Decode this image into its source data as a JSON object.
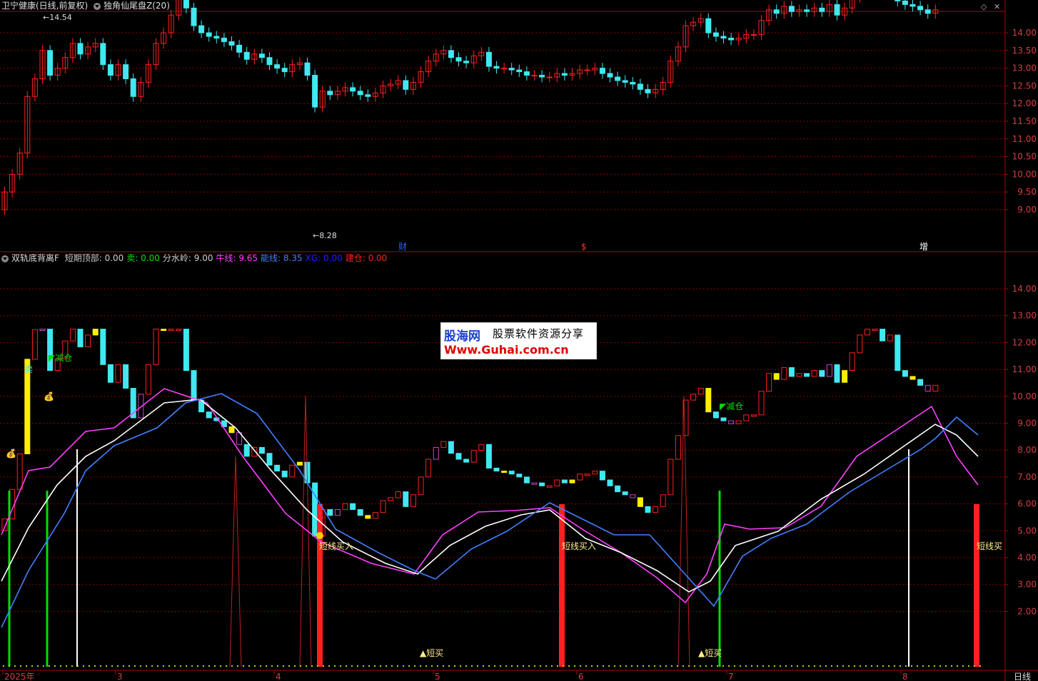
{
  "top_panel": {
    "stock_title": "卫宁健康(日线,前复权)",
    "indicator_title": "独角仙尾盘Z(20)",
    "y_ticks": [
      "14.00",
      "13.50",
      "13.00",
      "12.50",
      "12.00",
      "11.50",
      "11.00",
      "10.50",
      "10.00",
      "9.50",
      "9.00"
    ],
    "high_label": "14.54",
    "low_label": "8.28",
    "markers": [
      "财",
      "$",
      "增"
    ]
  },
  "bottom_panel": {
    "indicator_name": "双轨底背离F",
    "fields": [
      {
        "label": "短期顶部:",
        "value": "0.00",
        "color": "#cccccc"
      },
      {
        "label": "卖:",
        "value": "0.00",
        "color": "#00e000"
      },
      {
        "label": "分水岭:",
        "value": "9.00",
        "color": "#cccccc"
      },
      {
        "label": "牛线:",
        "value": "9.65",
        "color": "#ff40ff"
      },
      {
        "label": "能线:",
        "value": "8.35",
        "color": "#4080ff"
      },
      {
        "label": "XG:",
        "value": "0.00",
        "color": "#2020ff"
      },
      {
        "label": "建仓:",
        "value": "0.00",
        "color": "#ff2020"
      }
    ],
    "y_ticks": [
      "14.00",
      "13.00",
      "12.00",
      "11.00",
      "10.00",
      "9.00",
      "8.00",
      "7.00",
      "6.00",
      "5.00",
      "4.00",
      "3.00",
      "2.00"
    ],
    "annotations": {
      "sell": "卖",
      "reduce": "减仓",
      "short_buy_in": "短线买入",
      "short_buy": "短买",
      "short_buy_cut": "短线买"
    }
  },
  "x_axis": {
    "labels": [
      "2025年",
      "3",
      "4",
      "5",
      "6",
      "7",
      "8"
    ],
    "period_button": "日线"
  },
  "watermark": {
    "line1_brand": "股海网",
    "line1_text": "股票软件资源分享",
    "line2": "Www.Guhai.com.cn"
  },
  "colors": {
    "up": "#ff2020",
    "down": "#40e8f0",
    "grid": "#8b0000",
    "axis": "#b00000",
    "yellow": "#ffee00",
    "white": "#ffffff",
    "magenta": "#ff40ff",
    "blue": "#4080ff",
    "green": "#00e000"
  }
}
